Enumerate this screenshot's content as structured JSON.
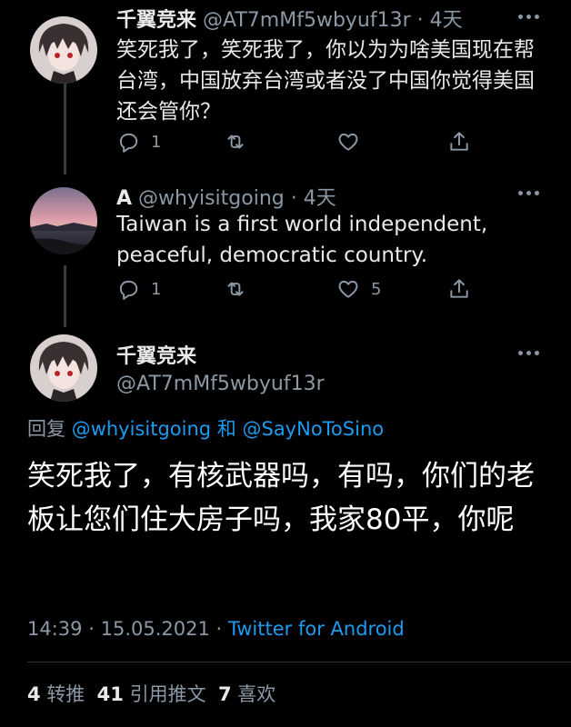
{
  "tweet1": {
    "name": "千翼竞来",
    "handle": "@AT7mMf5wbyuf13r",
    "dot": "·",
    "time": "4天",
    "text": "笑死我了，笑死我了，你以为为啥美国现在帮台湾，中国放弃台湾或者没了中国你觉得美国还会管你？",
    "reply_count": "1",
    "retweet_count": "",
    "like_count": ""
  },
  "tweet2": {
    "name": "A",
    "handle": "@whyisitgoing",
    "dot": "·",
    "time": "4天",
    "text": "Taiwan is a first world independent, peaceful, democratic country.",
    "reply_count": "1",
    "retweet_count": "",
    "like_count": "5"
  },
  "main_tweet": {
    "name": "千翼竞来",
    "handle": "@AT7mMf5wbyuf13r",
    "replying_prefix": "回复",
    "replying_user1": "@whyisitgoing",
    "replying_and": "和",
    "replying_user2": "@SayNoToSino",
    "text": "笑死我了，有核武器吗，有吗，你们的老板让您们住大房子吗，我家80平，你呢",
    "time": "14:39",
    "sep1": "·",
    "date": "15.05.2021",
    "sep2": "·",
    "source": "Twitter for Android",
    "retweets_num": "4",
    "retweets_label": "转推",
    "quotes_num": "41",
    "quotes_label": "引用推文",
    "likes_num": "7",
    "likes_label": "喜欢"
  },
  "colors": {
    "background": "#000000",
    "text": "#e7e9ea",
    "secondary": "#8b98a5",
    "link": "#1d9bf0",
    "divider": "#2f3336"
  },
  "icons": [
    "reply-icon",
    "retweet-icon",
    "like-icon",
    "share-icon",
    "more-icon"
  ]
}
